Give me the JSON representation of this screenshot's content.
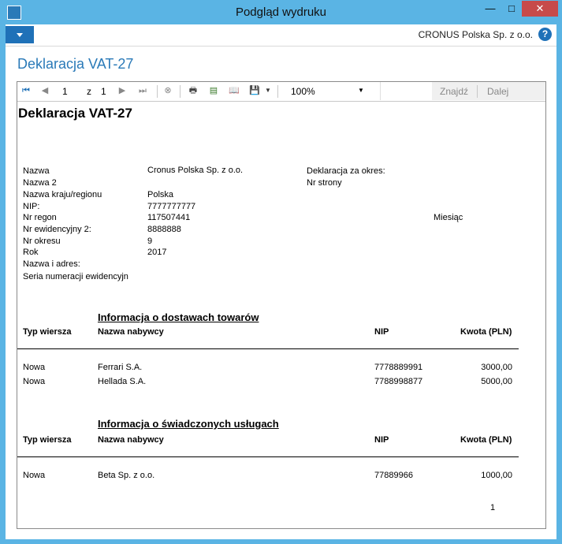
{
  "window": {
    "title": "Podgląd wydruku",
    "min": "—",
    "max": "□",
    "close": "✕"
  },
  "company": "CRONUS Polska Sp. z o.o.",
  "help": "?",
  "page_title": "Deklaracja VAT-27",
  "toolbar": {
    "page_current": "1",
    "page_of": "z",
    "page_total": "1",
    "zoom": "100%",
    "find": "Znajdź",
    "next": "Dalej"
  },
  "report": {
    "title": "Deklaracja VAT-27",
    "left_fields": [
      {
        "label": "Nazwa",
        "value": "Cronus Polska Sp. z o.o."
      },
      {
        "label": "Nazwa 2",
        "value": ""
      },
      {
        "label": "Nazwa kraju/regionu",
        "value": "Polska"
      },
      {
        "label": "NIP:",
        "value": "7777777777"
      },
      {
        "label": "Nr regon",
        "value": "117507441"
      },
      {
        "label": "Nr ewidencyjny 2:",
        "value": "8888888"
      },
      {
        "label": "Nr okresu",
        "value": "9"
      },
      {
        "label": "Rok",
        "value": "2017"
      },
      {
        "label": "Nazwa i adres:",
        "value": ""
      },
      {
        "label": "Seria numeracji ewidencyjn",
        "value": ""
      }
    ],
    "right_fields": [
      "Deklaracja za okres:",
      "Nr strony"
    ],
    "period_type": "Miesiąc",
    "sections": [
      {
        "title": "Informacja o dostawach towarów",
        "headers": [
          "Typ wiersza",
          "Nazwa nabywcy",
          "NIP",
          "Kwota (PLN)"
        ],
        "rows": [
          [
            "Nowa",
            "Ferrari S.A.",
            "7778889991",
            "3000,00"
          ],
          [
            "Nowa",
            "Hellada S.A.",
            "7788998877",
            "5000,00"
          ]
        ]
      },
      {
        "title": "Informacja o świadczonych usługach",
        "headers": [
          "Typ wiersza",
          "Nazwa nabywcy",
          "NIP",
          "Kwota (PLN)"
        ],
        "rows": [
          [
            "Nowa",
            "Beta Sp. z o.o.",
            "77889966",
            "1000,00"
          ]
        ]
      }
    ],
    "page_number": "1"
  }
}
